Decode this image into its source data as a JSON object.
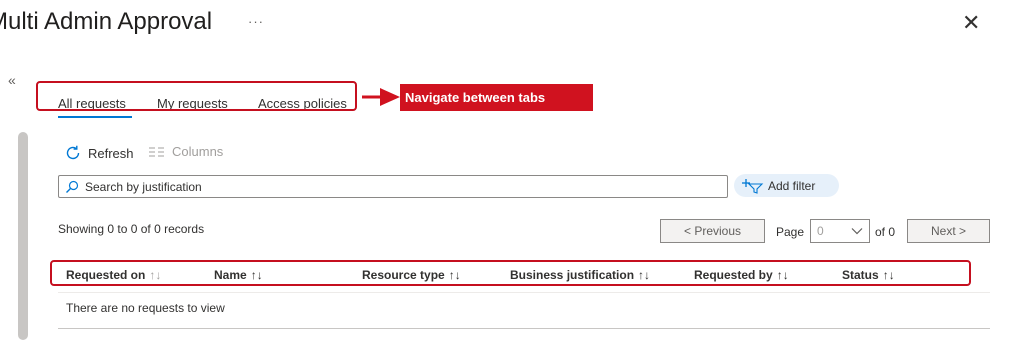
{
  "header": {
    "title": "Multi Admin Approval",
    "ellipsis": "···",
    "close": "✕"
  },
  "sidebar": {
    "collapse": "«"
  },
  "tabs": [
    {
      "label": "All requests",
      "active": true
    },
    {
      "label": "My requests",
      "active": false
    },
    {
      "label": "Access policies",
      "active": false
    }
  ],
  "callout": {
    "text": "Navigate between tabs"
  },
  "toolbar": {
    "refresh_label": "Refresh",
    "columns_label": "Columns"
  },
  "search": {
    "placeholder": "Search by justification"
  },
  "filter": {
    "add_label": "Add filter"
  },
  "records": {
    "text": "Showing 0 to 0 of 0 records"
  },
  "pagination": {
    "previous_label": "< Previous",
    "page_label": "Page",
    "page_value": "0",
    "of_label": "of 0",
    "next_label": "Next >"
  },
  "table": {
    "columns": [
      "Requested on",
      "Name",
      "Resource type",
      "Business justification",
      "Requested by",
      "Status"
    ],
    "sort_glyph": "↑↓",
    "empty_message": "There are no requests to view"
  },
  "colors": {
    "accent": "#0078d4",
    "annotation": "#d0121f"
  }
}
